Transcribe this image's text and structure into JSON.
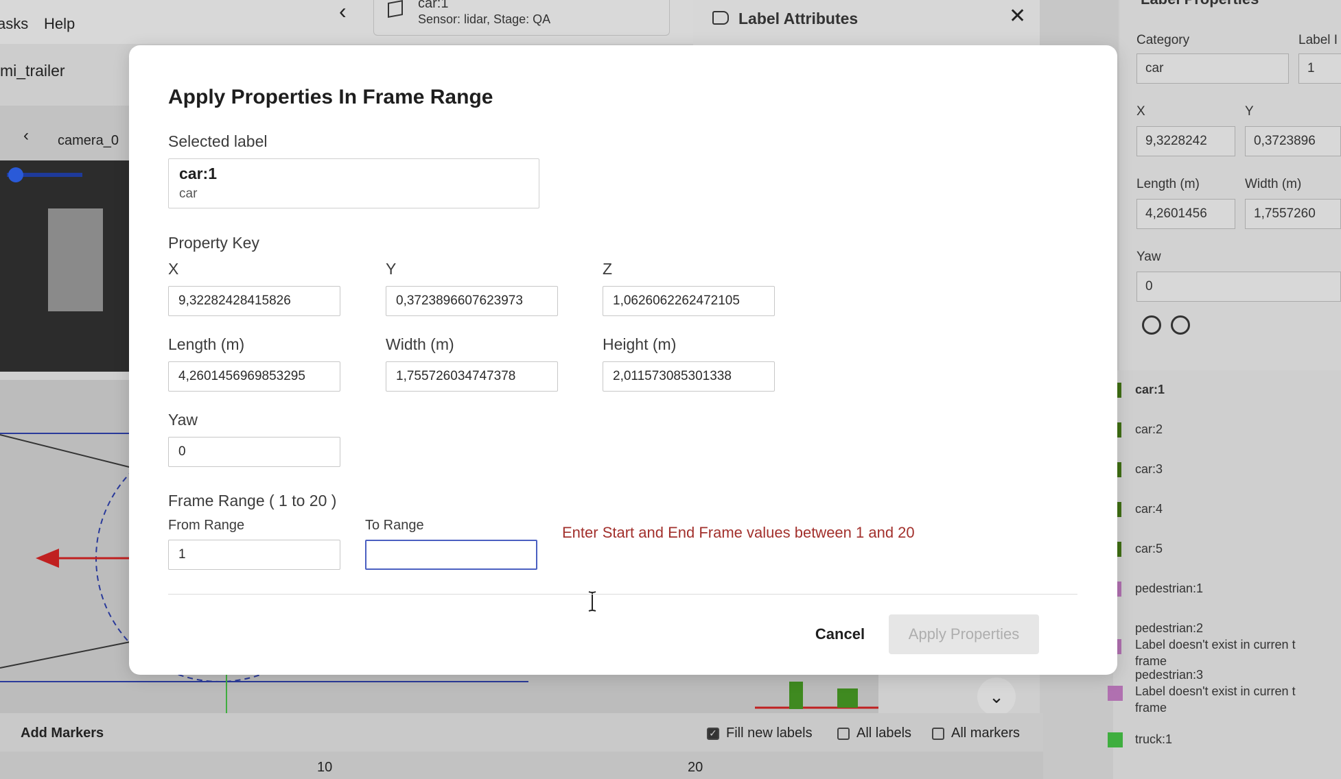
{
  "app": {
    "menu": [
      "asks",
      "Help"
    ],
    "toolbar_text": "mi_trailer",
    "label_card": {
      "title": "car:1",
      "subtitle": "Sensor: lidar, Stage: QA"
    },
    "label_attributes_title": "Label Attributes",
    "camera_name": "camera_0",
    "bottom": {
      "add_markers": "Add Markers",
      "fill_new_labels": "Fill new labels",
      "all_labels": "All labels",
      "all_markers": "All markers"
    },
    "ruler_ticks": [
      "10",
      "20"
    ]
  },
  "label_properties": {
    "title": "Label Properties",
    "category_label": "Category",
    "category_value": "car",
    "label_id_label": "Label I",
    "label_id_value": "1",
    "x_label": "X",
    "x_value": "9,3228242",
    "y_label": "Y",
    "y_value": "0,3723896",
    "length_label": "Length (m)",
    "length_value": "4,2601456",
    "width_label": "Width (m)",
    "width_value": "1,7557260",
    "yaw_label": "Yaw",
    "yaw_value": "0"
  },
  "label_list": [
    {
      "name": "car:1",
      "color": "#3f6e14",
      "bold": true
    },
    {
      "name": "car:2",
      "color": "#3f6e14"
    },
    {
      "name": "car:3",
      "color": "#3f6e14"
    },
    {
      "name": "car:4",
      "color": "#3f6e14"
    },
    {
      "name": "car:5",
      "color": "#3f6e14"
    },
    {
      "name": "pedestrian:1",
      "color": "#b070b0"
    },
    {
      "name": "pedestrian:2",
      "note": "Label doesn't exist in curren t frame",
      "color": "#b070b0"
    },
    {
      "name": "pedestrian:3",
      "note": "Label doesn't exist in curren t frame",
      "color": "#b070b0"
    },
    {
      "name": "truck:1",
      "color": "#3fae3f"
    }
  ],
  "modal": {
    "title": "Apply Properties In Frame Range",
    "selected_label_heading": "Selected label",
    "selected_label": {
      "id": "car:1",
      "category": "car"
    },
    "property_key_heading": "Property Key",
    "fields": {
      "x": {
        "label": "X",
        "value": "9,32282428415826"
      },
      "y": {
        "label": "Y",
        "value": "0,3723896607623973"
      },
      "z": {
        "label": "Z",
        "value": "1,0626062262472105"
      },
      "length": {
        "label": "Length (m)",
        "value": "4,2601456969853295"
      },
      "width": {
        "label": "Width (m)",
        "value": "1,755726034747378"
      },
      "height": {
        "label": "Height (m)",
        "value": "2,011573085301338"
      },
      "yaw": {
        "label": "Yaw",
        "value": "0"
      }
    },
    "frame_range_heading": "Frame Range ( 1 to 20 )",
    "from_label": "From Range",
    "from_value": "1",
    "to_label": "To Range",
    "to_value": "",
    "error": "Enter Start and End Frame values between 1 and 20",
    "cancel_label": "Cancel",
    "apply_label": "Apply Properties"
  },
  "colors": {
    "accent_border": "#4a5fc1",
    "error": "#a2302c"
  }
}
